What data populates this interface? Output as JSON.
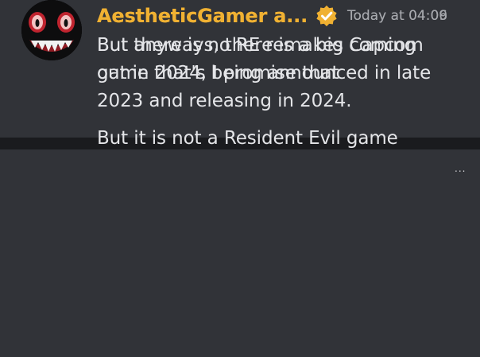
{
  "messages": [
    {
      "username": "AestheticGamer a...",
      "timestamp": "Today at 04:09",
      "avatar_icon": "demon-face-avatar",
      "badge_icon": "verified-check-icon",
      "lines": [
        "But there is no RE remakes coming",
        "out in 2024, I promise that"
      ]
    },
    {
      "username": "AestheticGamer a...",
      "timestamp": "Today at 04:06",
      "avatar_icon": "demon-face-avatar",
      "badge_icon": "verified-check-icon",
      "lines": [
        "But anyways, there is a big Capcom",
        "game that's being announced in late",
        "2023 and releasing in 2024."
      ],
      "followup": "But it is not a Resident Evil game"
    }
  ],
  "more_glyph": "...",
  "colors": {
    "background": "#1a1b1e",
    "card": "#313338",
    "username": "#f0b132",
    "text": "#e4e5e8",
    "timestamp": "#a7a9ae",
    "badge": "#f0b132"
  }
}
